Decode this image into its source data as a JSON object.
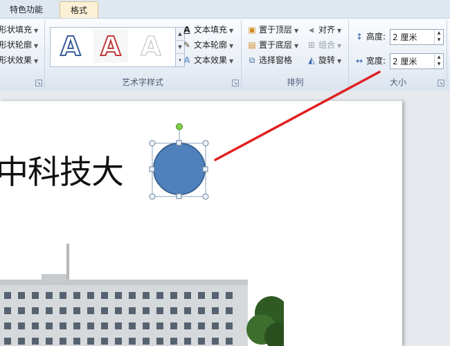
{
  "tabs": [
    {
      "label": "特色功能"
    },
    {
      "label": "格式"
    }
  ],
  "shape_styles": {
    "fill": "形状填充",
    "outline": "形状轮廓",
    "effects": "形状效果"
  },
  "wordart": {
    "gallery": [
      "A",
      "A",
      "A"
    ],
    "text_fill": "文本填充",
    "text_outline": "文本轮廓",
    "text_effects": "文本效果",
    "group_label": "艺术字样式"
  },
  "arrange": {
    "bring_front": "置于顶层",
    "send_back": "置于底层",
    "selection_pane": "选择窗格",
    "align": "对齐",
    "group": "组合",
    "rotate": "旋转",
    "group_label": "排列"
  },
  "size": {
    "height_label": "高度:",
    "height_value": "2 厘米",
    "width_label": "宽度:",
    "width_value": "2 厘米",
    "group_label": "大小"
  },
  "document": {
    "text": "中科技大"
  },
  "colors": {
    "shape_fill": "#4f81bd",
    "shape_outline": "#3a6391",
    "annotation": "#e02020"
  }
}
